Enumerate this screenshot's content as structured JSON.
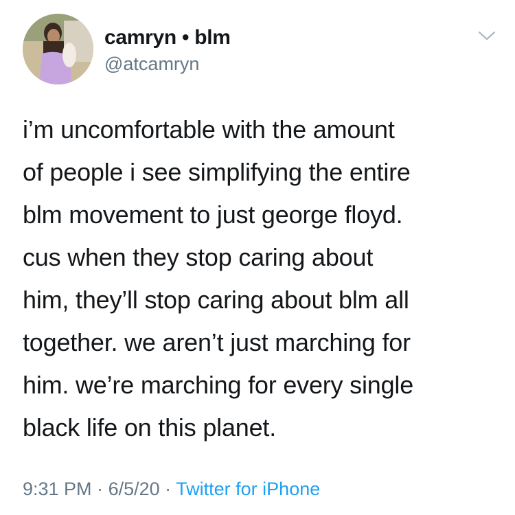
{
  "tweet": {
    "display_name": "camryn • blm",
    "handle": "@atcamryn",
    "text_lines": [
      "i’m uncomfortable with the amount",
      "of people i see simplifying the entire",
      "blm movement to just george floyd.",
      "cus when they stop caring about",
      "him, they’ll stop caring about blm all",
      "together. we aren’t just marching for",
      "him. we’re marching for every single",
      "black life on this planet."
    ],
    "time": "9:31 PM",
    "separator": " · ",
    "date": "6/5/20",
    "source": "Twitter for iPhone"
  },
  "colors": {
    "text": "#14171a",
    "secondary": "#657786",
    "link": "#1da1f2",
    "chevron": "#aab8c2"
  },
  "icons": {
    "avatar": "profile-photo",
    "menu": "chevron-down-icon"
  }
}
